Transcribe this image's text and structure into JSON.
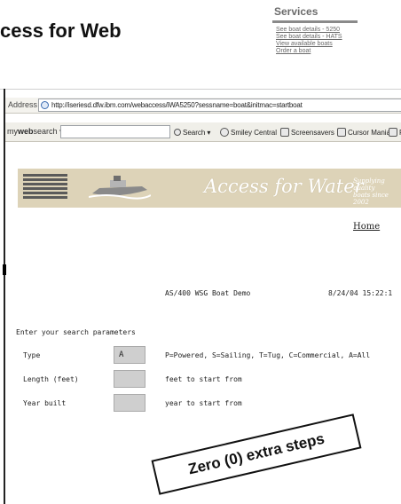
{
  "slide": {
    "title": "cess for Web"
  },
  "services": {
    "header": "Services",
    "links": [
      "See boat details - 5250",
      "See boat details - HATS",
      "View available boats",
      "Order a boat"
    ]
  },
  "browser": {
    "address_label": "Address",
    "url": "http://iseriesd.dfw.ibm.com/webaccess/iWA5250?sessname=boat&initmac=startboat",
    "toolbar": {
      "brand_prefix": "my",
      "brand_bold": "web",
      "brand_suffix": "search",
      "search_label": "Search",
      "smiley_label": "Smiley Central",
      "screensavers_label": "Screensavers",
      "cursor_label": "Cursor Mania",
      "trailing_label": "F"
    }
  },
  "page": {
    "banner_title": "Access for Water",
    "banner_tagline_1": "Supplying quality",
    "banner_tagline_2": "boats since 2002",
    "home_link": "Home",
    "session_title": "AS/400 WSG Boat Demo",
    "timestamp": "8/24/04 15:22:1",
    "search_heading": "Enter your search parameters",
    "rows": [
      {
        "label": "Type",
        "value": "A",
        "hint": "P=Powered, S=Sailing, T=Tug, C=Commercial, A=All"
      },
      {
        "label": "Length (feet)",
        "value": "",
        "hint": "feet to start from"
      },
      {
        "label": "Year built",
        "value": "",
        "hint": "year to start from"
      }
    ]
  },
  "callout": {
    "text": "Zero (0) extra steps"
  }
}
